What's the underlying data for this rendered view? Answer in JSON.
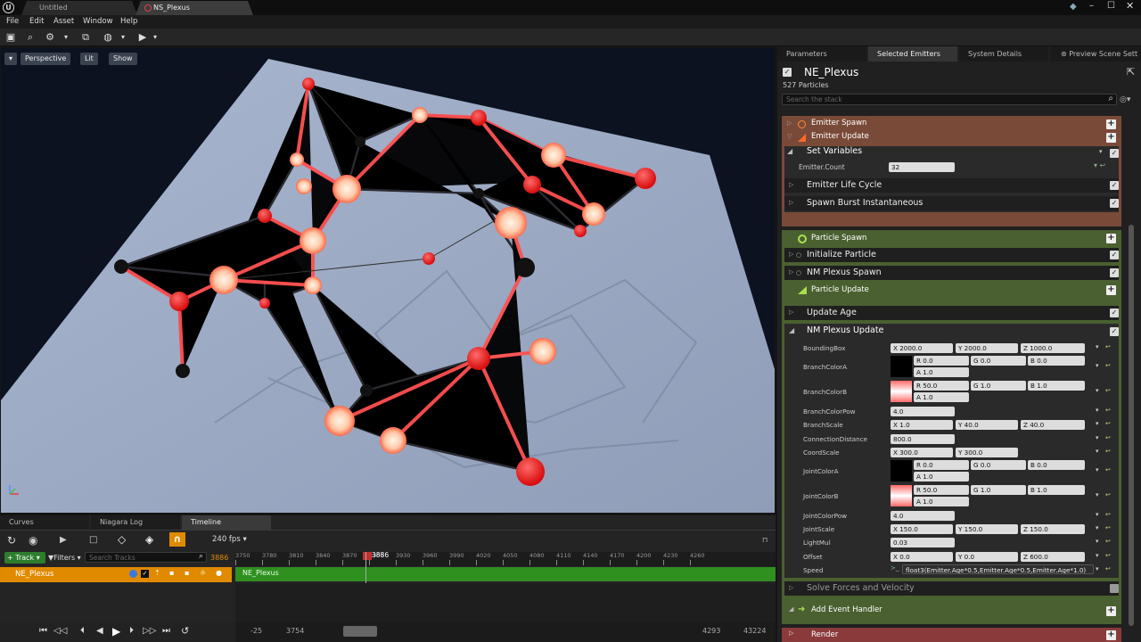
{
  "window": {
    "tabs": [
      {
        "label": "Untitled"
      },
      {
        "label": "NS_Plexus"
      }
    ]
  },
  "menu": [
    "File",
    "Edit",
    "Asset",
    "Window",
    "Help"
  ],
  "viewport": {
    "perspective_label": "Perspective",
    "lit_label": "Lit",
    "show_label": "Show"
  },
  "bottom": {
    "tabs": [
      "Curves",
      "Niagara Log",
      "Timeline"
    ],
    "fps": "240 fps",
    "track_label": "Track",
    "filters_label": "Filters",
    "search_placeholder": "Search Tracks",
    "current_frame": "3886",
    "frame_field": "3886",
    "ticks": [
      "3750",
      "3780",
      "3810",
      "3840",
      "3870",
      "3900",
      "3930",
      "3960",
      "3990",
      "4020",
      "4050",
      "4080",
      "4110",
      "4140",
      "4170",
      "4200",
      "4230",
      "4260"
    ],
    "track_name": "NE_Plexus",
    "bar_label": "NE_Plexus",
    "nav_start": "-25",
    "nav_start2": "3754",
    "nav_end": "4293",
    "nav_end2": "43224"
  },
  "panel": {
    "tabs": [
      "Parameters",
      "Selected Emitters",
      "System Details",
      "Preview Scene Sett"
    ],
    "emitter_name": "NE_Plexus",
    "particles": "527 Particles",
    "search_placeholder": "Search the stack",
    "emitter_spawn": "Emitter Spawn",
    "emitter_update": "Emitter Update",
    "set_variables": "Set Variables",
    "emitter_count_label": "Emitter.Count",
    "emitter_count_value": "32",
    "emitter_life": "Emitter Life Cycle",
    "spawn_burst": "Spawn Burst Instantaneous",
    "particle_spawn": "Particle Spawn",
    "init_particle": "Initialize Particle",
    "plexus_spawn": "NM Plexus Spawn",
    "particle_update": "Particle Update",
    "update_age": "Update Age",
    "plexus_update": "NM Plexus Update",
    "params": {
      "bounding_box": {
        "label": "BoundingBox",
        "x": "X 2000.0",
        "y": "Y 2000.0",
        "z": "Z 1000.0"
      },
      "branch_color_a": {
        "label": "BranchColorA",
        "r": "R 0.0",
        "g": "G 0.0",
        "b": "B 0.0",
        "a": "A 1.0",
        "swatch": "#000000"
      },
      "branch_color_b": {
        "label": "BranchColorB",
        "r": "R 50.0",
        "g": "G 1.0",
        "b": "B 1.0",
        "a": "A 1.0",
        "swatch": "#ff6a6a"
      },
      "branch_color_pow": {
        "label": "BranchColorPow",
        "v": "4.0"
      },
      "branch_scale": {
        "label": "BranchScale",
        "x": "X 1.0",
        "y": "Y 40.0",
        "z": "Z 40.0"
      },
      "connection_distance": {
        "label": "ConnectionDistance",
        "v": "800.0"
      },
      "coord_scale": {
        "label": "CoordScale",
        "x": "X 300.0",
        "y": "Y 300.0"
      },
      "joint_color_a": {
        "label": "JointColorA",
        "r": "R 0.0",
        "g": "G 0.0",
        "b": "B 0.0",
        "a": "A 1.0",
        "swatch": "#000000"
      },
      "joint_color_b": {
        "label": "JointColorB",
        "r": "R 50.0",
        "g": "G 1.0",
        "b": "B 1.0",
        "a": "A 1.0",
        "swatch": "#ff6a6a"
      },
      "joint_color_pow": {
        "label": "JointColorPow",
        "v": "4.0"
      },
      "joint_scale": {
        "label": "JointScale",
        "x": "X 150.0",
        "y": "Y 150.0",
        "z": "Z 150.0"
      },
      "light_mul": {
        "label": "LightMul",
        "v": "0.03"
      },
      "offset": {
        "label": "Offset",
        "x": "X 0.0",
        "y": "Y 0.0",
        "z": "Z 600.0"
      },
      "speed": {
        "label": "Speed",
        "v": "float3(Emitter.Age*0.5,Emitter.Age*0.5,Emitter.Age*1.0)"
      }
    },
    "solve_forces": "Solve Forces and Velocity",
    "add_event": "Add Event Handler",
    "render": "Render"
  },
  "colors": {
    "accent": "#e08a00",
    "emitter": "#7a4a38",
    "particle": "#4a6030",
    "track": "#2f8f1f"
  }
}
